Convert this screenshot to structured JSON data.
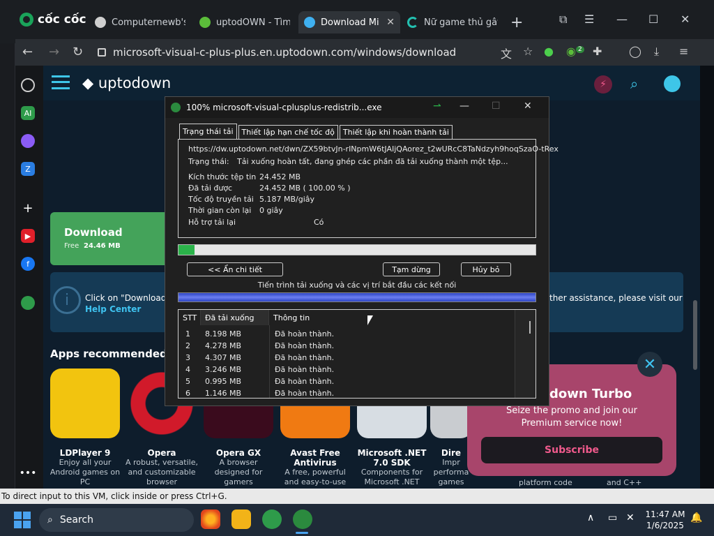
{
  "browser": {
    "logo_text": "cốc cốc",
    "tabs": [
      {
        "label": "Computernewb's I",
        "color": "#cfcfcf"
      },
      {
        "label": "uptodOWN - Tìm",
        "color": "#5bbd3a"
      },
      {
        "label": "Download Mi",
        "color": "#3fb0f0"
      },
      {
        "label": "Nữ game thủ gây",
        "color": "#23c0b0"
      }
    ],
    "new_tab": "+",
    "url": "microsoft-visual-c-plus-plus.en.uptodown.com/windows/download",
    "extension_badge": "2"
  },
  "site": {
    "logo": "uptodown",
    "download_card": {
      "label": "Download",
      "free": "Free",
      "size": "24.46 MB"
    },
    "info": {
      "text": "Click on \"Download\" t",
      "link": "Help Center",
      "right_text": "ther assistance, please visit our"
    },
    "apps_title": "Apps recommended fo",
    "apps": [
      {
        "name": "LDPlayer 9",
        "desc": [
          "Enjoy all your",
          "Android games on",
          "PC"
        ],
        "color": "#f2c40f"
      },
      {
        "name": "Opera",
        "desc": [
          "A robust, versatile,",
          "and customizable",
          "browser"
        ],
        "color": "#d11a2a"
      },
      {
        "name": "Opera GX",
        "desc": [
          "A browser",
          "designed for",
          "gamers"
        ],
        "color": "#3a0b1d"
      },
      {
        "name": "Avast Free Antivirus",
        "desc": [
          "A free, powerful",
          "and easy-to-use"
        ],
        "color": "#f07a12"
      },
      {
        "name": "Microsoft .NET 7.0 SDK",
        "desc": [
          "Components for",
          "Microsoft .NET"
        ],
        "color": "#d7dde3"
      },
      {
        "name": "Dire",
        "desc": [
          "Impr",
          "performa",
          "games and..."
        ],
        "color": "#c9ccd0"
      }
    ],
    "promo": {
      "title": "down Turbo",
      "subtitle": "Seize the promo and join our Premium service now!",
      "button": "Subscribe",
      "below_left": "platform code",
      "below_right": "and C++"
    }
  },
  "dialog": {
    "title": "100% microsoft-visual-cplusplus-redistrib...exe",
    "tabs": [
      "Trạng thái tải",
      "Thiết lập hạn chế tốc độ",
      "Thiết lập khi hoàn thành tải"
    ],
    "url": "https://dw.uptodown.net/dwn/ZX59btvJn-rINpmW6tJAIjQAorez_t2wURcC8TaNdzyh9hoqSzaO-tRex",
    "status_label": "Trạng thái:",
    "status_value": "Tải xuống hoàn tất, đang ghép các phần đã tải xuống thành một tệp...",
    "fields": [
      {
        "label": "Kích thước tệp tin",
        "value": "24.452  MB"
      },
      {
        "label": "Đã tải được",
        "value": "24.452  MB  ( 100.00 % )"
      },
      {
        "label": "Tốc độ truyền tải",
        "value": "5.187  MB/giây"
      },
      {
        "label": "Thời gian còn lại",
        "value": "0 giây"
      },
      {
        "label": "Hỗ trợ tải lại",
        "value": "Có"
      }
    ],
    "progress_fraction": 0.045,
    "buttons": {
      "hide": "<< Ẩn chi tiết",
      "pause": "Tạm dừng",
      "cancel": "Hủy bỏ"
    },
    "segment_caption": "Tiến trình tải xuống và các vị trí bắt đầu các kết nối",
    "table": {
      "headers": [
        "STT",
        "Đã tải xuống",
        "Thông tin"
      ],
      "rows": [
        [
          "1",
          "8.198  MB",
          "Đã hoàn thành."
        ],
        [
          "2",
          "4.278  MB",
          "Đã hoàn thành."
        ],
        [
          "3",
          "4.307  MB",
          "Đã hoàn thành."
        ],
        [
          "4",
          "3.246  MB",
          "Đã hoàn thành."
        ],
        [
          "5",
          "0.995  MB",
          "Đã hoàn thành."
        ],
        [
          "6",
          "1.146  MB",
          "Đã hoàn thành."
        ]
      ]
    }
  },
  "vm_status": "To direct input to this VM, click inside or press Ctrl+G.",
  "taskbar": {
    "search": "Search",
    "time": "11:47 AM",
    "date": "1/6/2025"
  }
}
